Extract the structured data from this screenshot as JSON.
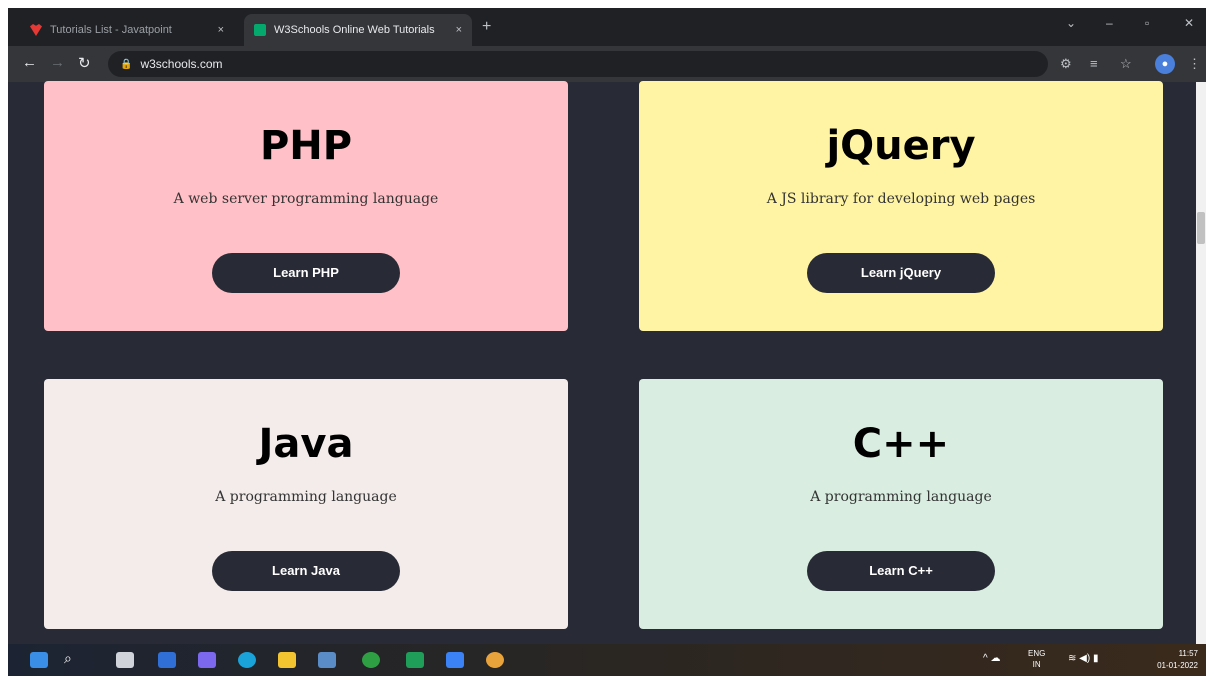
{
  "browser": {
    "tabs": [
      {
        "title": "Tutorials List - Javatpoint",
        "close": "×"
      },
      {
        "title": "W3Schools Online Web Tutorials",
        "close": "×"
      }
    ],
    "new_tab": "+",
    "window_controls": {
      "minimize": "–",
      "maximize": "▫",
      "close": "✕"
    },
    "url": "w3schools.com"
  },
  "cards": [
    {
      "title": "PHP",
      "desc": "A web server programming language",
      "button": "Learn PHP",
      "color": "#FFC0C7"
    },
    {
      "title": "jQuery",
      "desc": "A JS library for developing web pages",
      "button": "Learn jQuery",
      "color": "#FFF4A3"
    },
    {
      "title": "Java",
      "desc": "A programming language",
      "button": "Learn Java",
      "color": "#F3ECEA"
    },
    {
      "title": "C++",
      "desc": "A programming language",
      "button": "Learn C++",
      "color": "#D9EEE1"
    }
  ],
  "taskbar": {
    "lang_line1": "ENG",
    "lang_line2": "IN",
    "time": "11:57",
    "date": "01-01-2022"
  },
  "colors": {
    "page_bg": "#282A35",
    "accent": "#04AA6D"
  }
}
